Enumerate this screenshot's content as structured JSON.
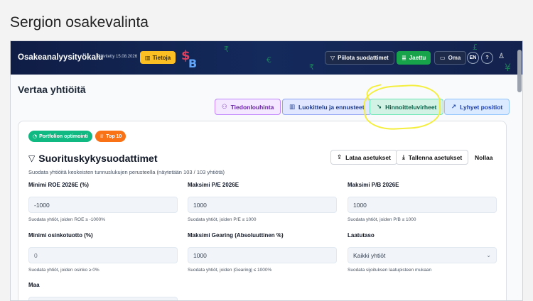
{
  "page": {
    "title": "Sergion osakevalinta"
  },
  "topbar": {
    "app_name": "Osakeanalyysityökalu",
    "date": "Päivitetty 15.08.2026",
    "info_label": "Tietoja",
    "hide_filters_label": "Piilota suodattimet",
    "shared_label": "Jaettu",
    "own_label": "Oma",
    "lang_label": "EN",
    "help_label": "?"
  },
  "compare": {
    "heading": "Vertaa yhtiöitä",
    "tabs": [
      {
        "label": "Tiedonlouhinta"
      },
      {
        "label": "Luokittelu ja ennusteet"
      },
      {
        "label": "Hinnoitteluvirheet"
      },
      {
        "label": "Lyhyet positiot"
      }
    ]
  },
  "card": {
    "pills": [
      {
        "label": "Portfolion optimointi"
      },
      {
        "label": "Top 10"
      }
    ],
    "title": "Suorituskykysuodattimet",
    "subtitle": "Suodata yhtiöitä keskeisten tunnuslukujen perusteella (näytetään 103 / 103 yhtiötä)",
    "actions": {
      "load": "Lataa asetukset",
      "save": "Tallenna asetukset",
      "reset": "Nollaa"
    },
    "fields": [
      {
        "label": "Minimi ROE 2026E (%)",
        "value": "-1000",
        "help": "Suodata yhtiöt, joiden ROE ≥ -1000%"
      },
      {
        "label": "Maksimi P/E 2026E",
        "value": "1000",
        "help": "Suodata yhtiöt, joiden P/E ≤ 1000"
      },
      {
        "label": "Maksimi P/B 2026E",
        "value": "1000",
        "help": "Suodata yhtiöt, joiden P/B ≤ 1000"
      },
      {
        "label": "Minimi osinkotuotto (%)",
        "value": "0",
        "help": "Suodata yhtiöt, joiden osinko ≥ 0%"
      },
      {
        "label": "Maksimi Gearing (Absoluuttinen %)",
        "value": "1000",
        "help": "Suodata yhtiöt, joiden |Gearing| ≤ 1000%"
      },
      {
        "label": "Laatutaso",
        "value": "Kaikki yhtiöt",
        "help": "Suodata sijoituksen laatupisteen mukaan"
      },
      {
        "label": "Maa",
        "value": "",
        "help": ""
      }
    ]
  },
  "colors": {
    "topbar_bg": "#13214d",
    "accent_green": "#16a34a",
    "info_yellow": "#fbbf24",
    "annotation": "#f4ef3f"
  }
}
